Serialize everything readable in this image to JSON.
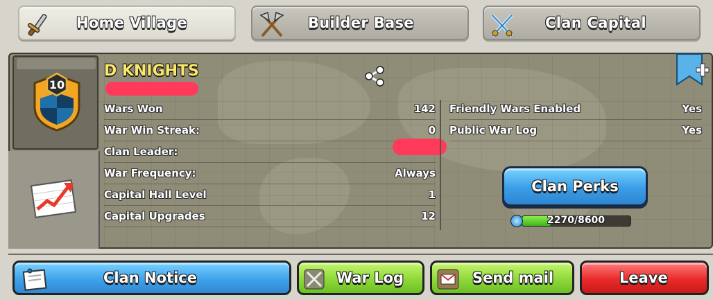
{
  "tabs": [
    {
      "label": "Home Village",
      "icon": "sword-icon",
      "active": true
    },
    {
      "label": "Builder Base",
      "icon": "crossed-axes-icon",
      "active": false
    },
    {
      "label": "Clan Capital",
      "icon": "crossed-swords-icon",
      "active": false
    }
  ],
  "clan": {
    "name": "D KNIGHTS",
    "level": "10"
  },
  "stats_left": [
    {
      "label": "Wars Won",
      "value": "142"
    },
    {
      "label": "War Win Streak:",
      "value": "0"
    },
    {
      "label": "Clan Leader:",
      "value": ""
    },
    {
      "label": "War Frequency:",
      "value": "Always"
    },
    {
      "label": "Capital Hall Level",
      "value": "1"
    },
    {
      "label": "Capital Upgrades",
      "value": "12"
    }
  ],
  "stats_right": [
    {
      "label": "Friendly Wars Enabled",
      "value": "Yes"
    },
    {
      "label": "Public War Log",
      "value": "Yes"
    }
  ],
  "perks": {
    "button_label": "Clan Perks",
    "progress_text": "2270/8600",
    "progress_fraction": 0.264
  },
  "buttons": {
    "clan_notice": "Clan Notice",
    "war_log": "War Log",
    "send_mail": "Send mail",
    "leave": "Leave"
  },
  "colors": {
    "clan_name": "#fbe76a",
    "blue_button": "#3fa2ea",
    "green_button": "#8fd93a",
    "red_button": "#e92a2a"
  }
}
